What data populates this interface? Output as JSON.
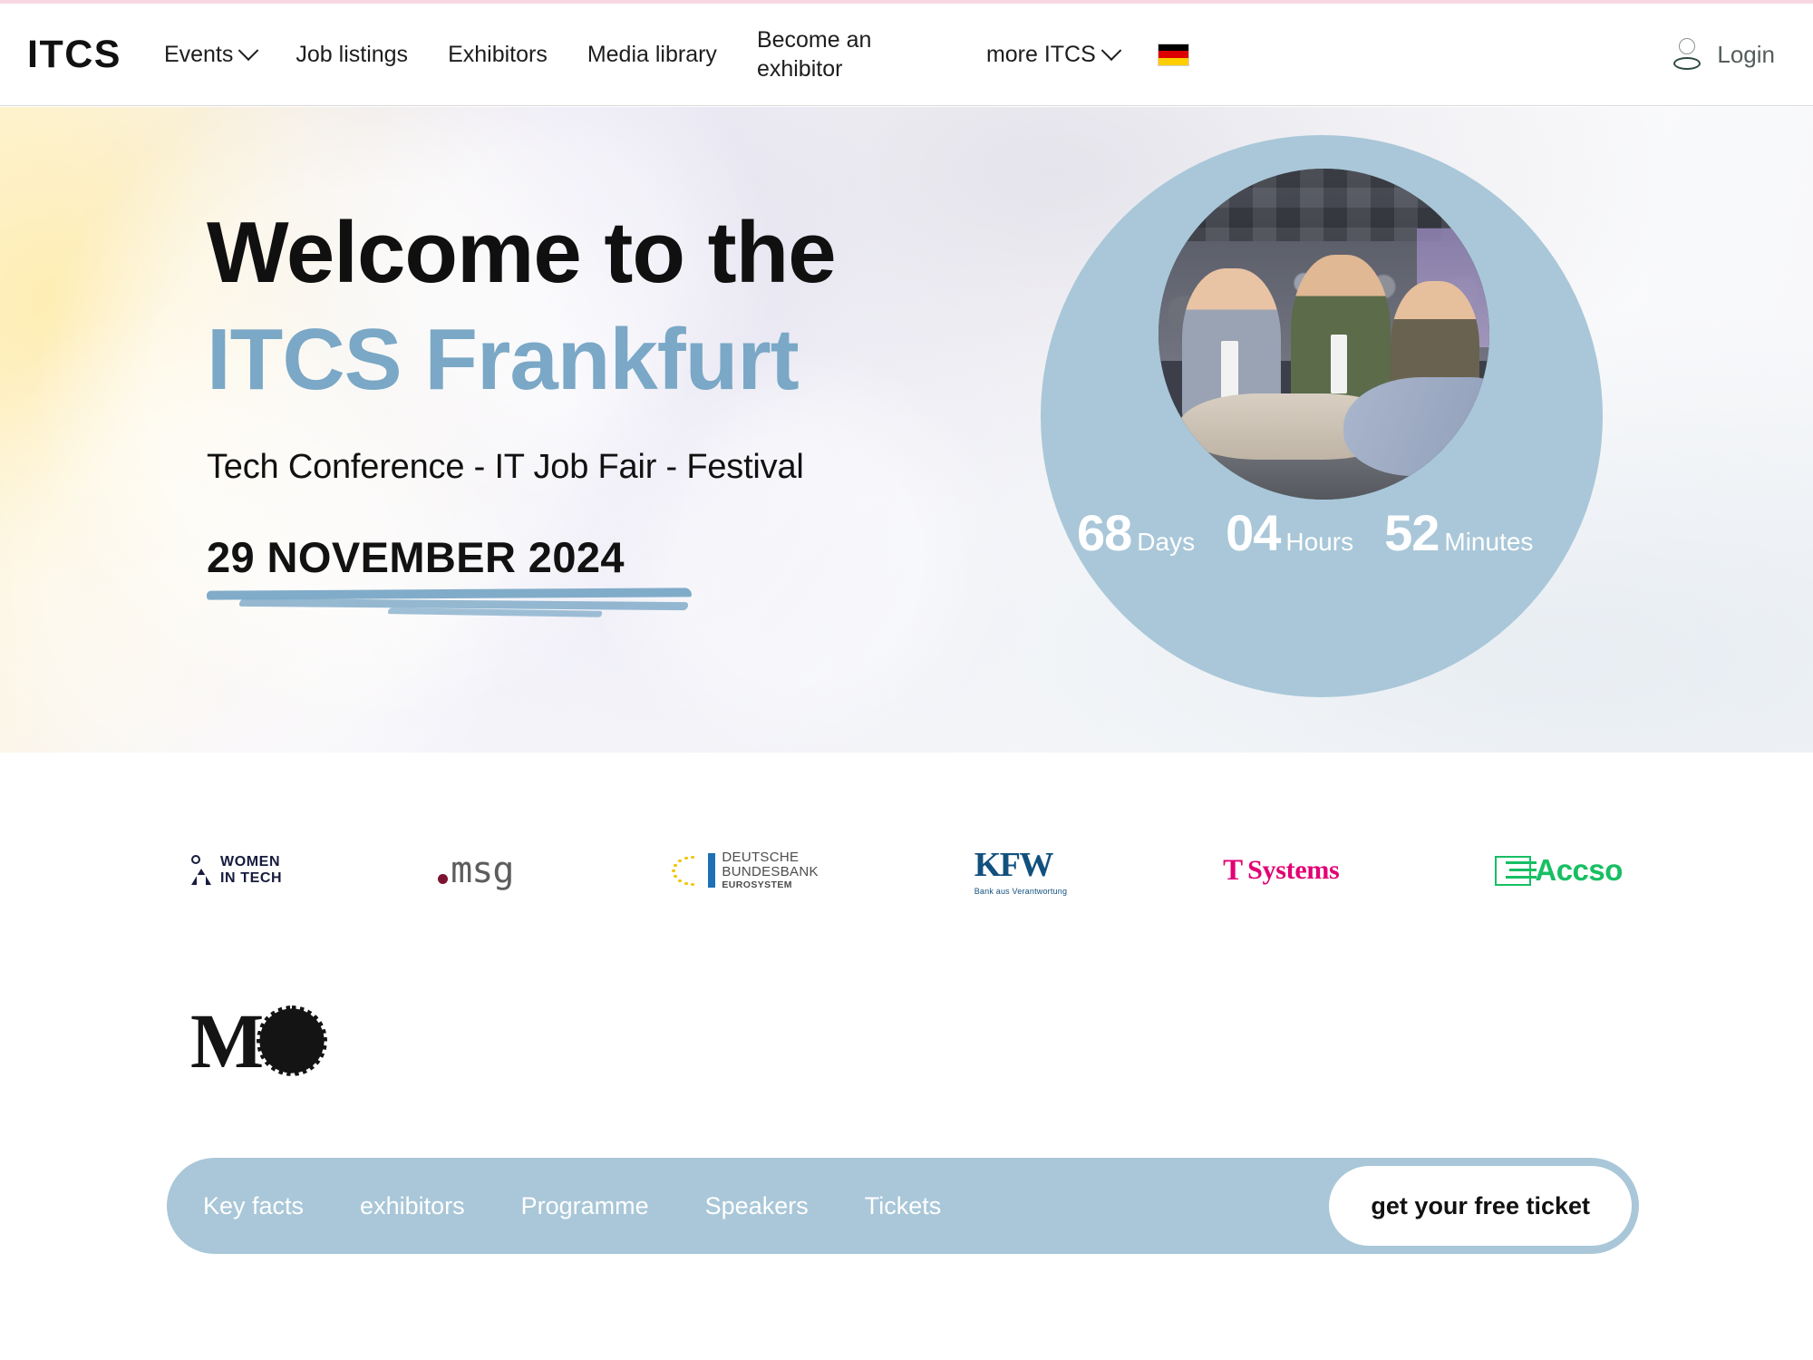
{
  "header": {
    "brand": "ITCS",
    "nav": [
      {
        "label": "Events",
        "has_dropdown": true
      },
      {
        "label": "Job listings",
        "has_dropdown": false
      },
      {
        "label": "Exhibitors",
        "has_dropdown": false
      },
      {
        "label": "Media library",
        "has_dropdown": false
      },
      {
        "label": "Become an exhibitor",
        "has_dropdown": false,
        "two_line": true
      },
      {
        "label": "more ITCS",
        "has_dropdown": true
      }
    ],
    "language_flag": "germany-flag",
    "login_label": "Login",
    "login_icon": "person-icon"
  },
  "hero": {
    "title_line1": "Welcome to the",
    "title_line2": "ITCS Frankfurt",
    "subtitle": "Tech Conference - IT Job Fair - Festival",
    "date": "29 NOVEMBER 2024",
    "accent_color": "#7aa8c6",
    "circle_color": "#a9c7d8",
    "countdown": [
      {
        "value": "68",
        "unit": "Days"
      },
      {
        "value": "04",
        "unit": "Hours"
      },
      {
        "value": "52",
        "unit": "Minutes"
      }
    ]
  },
  "sponsors": {
    "row1": [
      {
        "name": "WOMEN IN TECH",
        "line1": "WOMEN",
        "line2": "IN TECH",
        "color": "#161b3d"
      },
      {
        "name": ".msg",
        "text": "msg",
        "color": "#5d5d5d",
        "dot_color": "#7b1430"
      },
      {
        "name": "Deutsche Bundesbank",
        "line1": "DEUTSCHE",
        "line2": "BUNDESBANK",
        "line3": "EUROSYSTEM",
        "color": "#4c4c4c"
      },
      {
        "name": "KfW",
        "text": "KFW",
        "tagline": "Bank aus Verantwortung",
        "color": "#12507e"
      },
      {
        "name": "T-Systems",
        "mark": "T",
        "text": "Systems",
        "color": "#e20074"
      },
      {
        "name": "Accso",
        "text": "Accso",
        "color": "#17bf63"
      }
    ],
    "row2": [
      {
        "name": "MO",
        "text": "M",
        "mark": "gear-icon",
        "color": "#141414"
      }
    ]
  },
  "bottom_bar": {
    "background": "#a9c7d8",
    "links": [
      {
        "label": "Key facts"
      },
      {
        "label": "exhibitors"
      },
      {
        "label": "Programme"
      },
      {
        "label": "Speakers"
      },
      {
        "label": "Tickets"
      }
    ],
    "cta_label": "get your free ticket"
  }
}
